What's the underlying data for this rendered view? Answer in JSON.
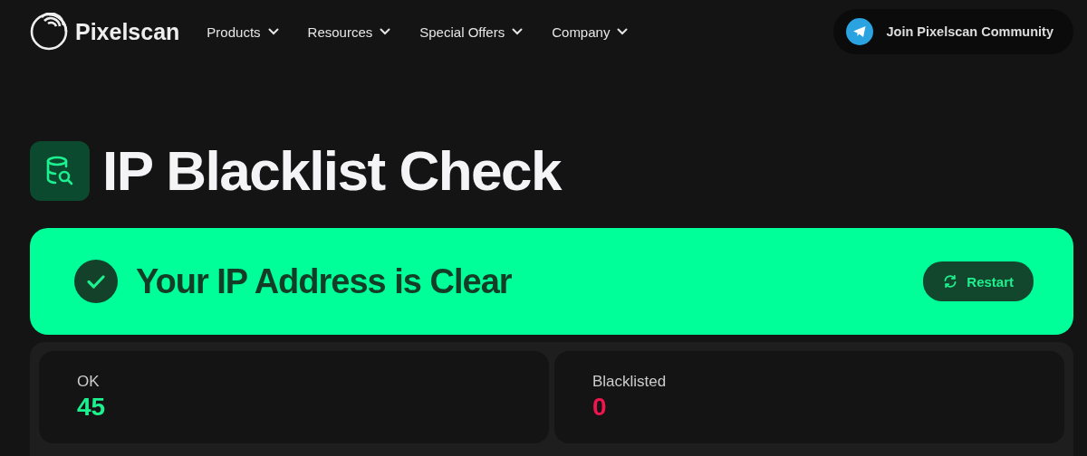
{
  "header": {
    "logo": "Pixelscan",
    "nav": [
      {
        "label": "Products"
      },
      {
        "label": "Resources"
      },
      {
        "label": "Special Offers"
      },
      {
        "label": "Company"
      }
    ],
    "community_button": "Join Pixelscan Community"
  },
  "title": "IP Blacklist Check",
  "result": {
    "message": "Your IP Address is Clear",
    "button": "Restart"
  },
  "stats": [
    {
      "label": "OK",
      "value": "45",
      "color": "#1cf08f"
    },
    {
      "label": "Blacklisted",
      "value": "0",
      "color": "#f0154f"
    }
  ]
}
